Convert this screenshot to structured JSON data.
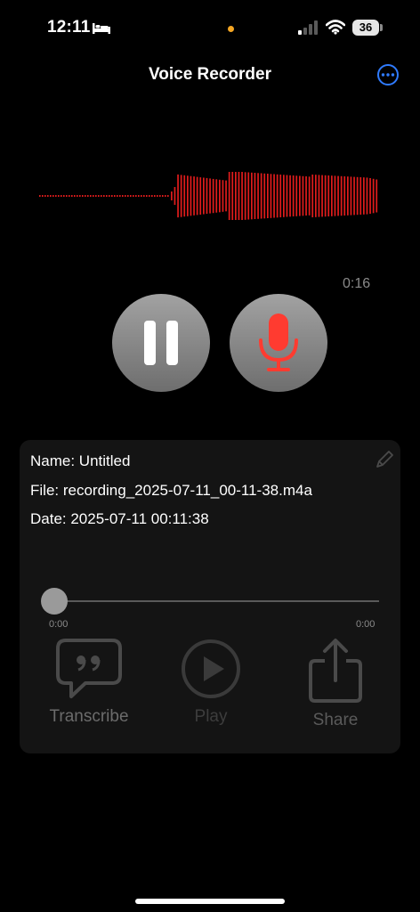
{
  "status_bar": {
    "time": "12:11",
    "battery": "36"
  },
  "nav": {
    "title": "Voice Recorder",
    "more_icon": "ellipsis-circle-icon"
  },
  "recorder": {
    "elapsed": "0:16",
    "pause_icon": "pause-icon",
    "mic_icon": "microphone-icon",
    "waveform_color": "#e01c1c"
  },
  "recording": {
    "name_line": "Name: Untitled",
    "file_line": "File: recording_2025-07-11_00-11-38.m4a",
    "date_line": "Date: 2025-07-11 00:11:38",
    "position": "0:00",
    "duration": "0:00",
    "progress_fraction": 0
  },
  "actions": {
    "transcribe_label": "Transcribe",
    "play_label": "Play",
    "share_label": "Share"
  },
  "colors": {
    "accent": "#2f7bff",
    "mic": "#ff3b30",
    "card_bg": "#141414"
  }
}
